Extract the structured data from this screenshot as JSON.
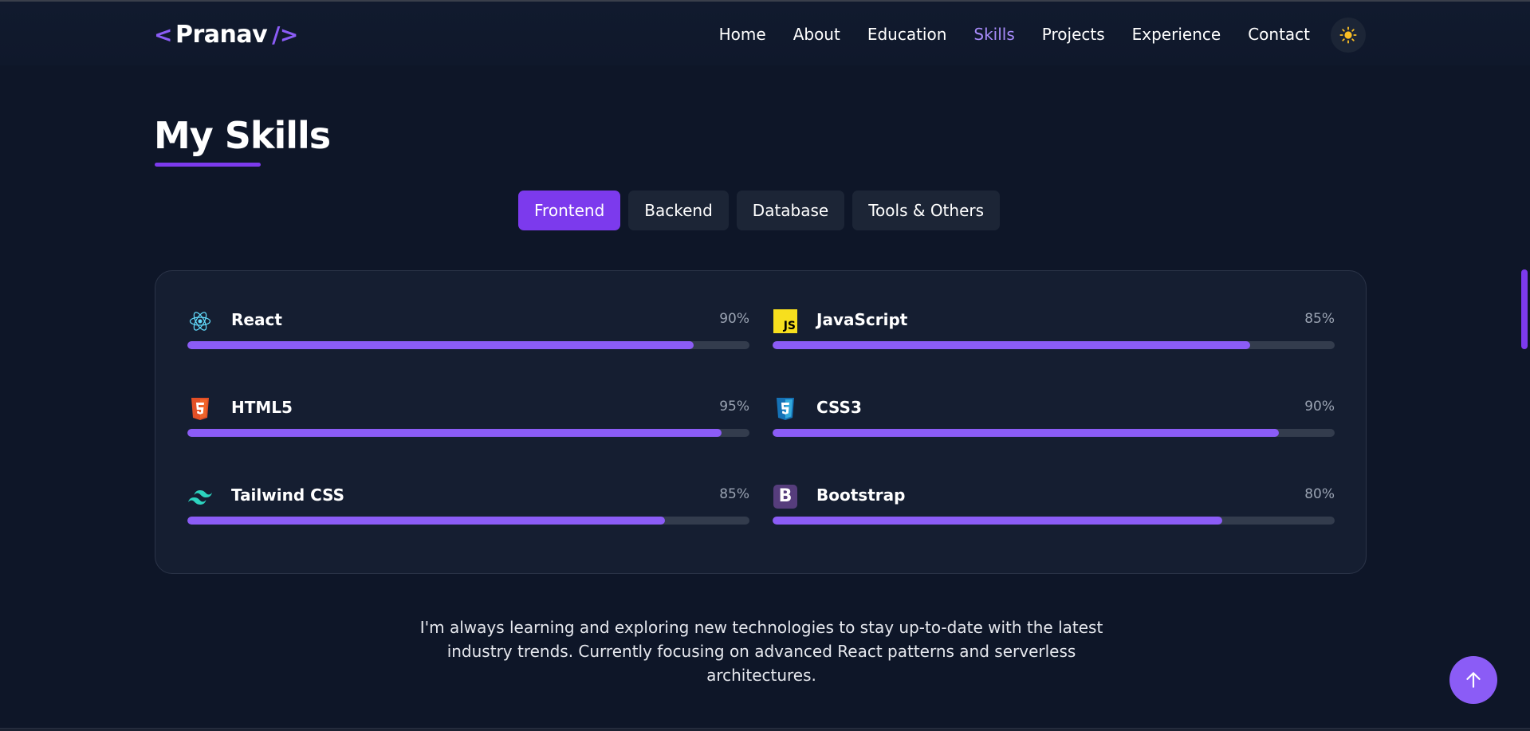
{
  "logo": {
    "open": "<",
    "name": "Pranav",
    "close": "/>"
  },
  "nav": {
    "items": [
      {
        "label": "Home"
      },
      {
        "label": "About"
      },
      {
        "label": "Education"
      },
      {
        "label": "Skills",
        "active": true
      },
      {
        "label": "Projects"
      },
      {
        "label": "Experience"
      },
      {
        "label": "Contact"
      }
    ],
    "theme_toggle_icon": "sun-icon"
  },
  "section": {
    "title": "My Skills",
    "tabs": [
      {
        "label": "Frontend",
        "active": true
      },
      {
        "label": "Backend"
      },
      {
        "label": "Database"
      },
      {
        "label": "Tools & Others"
      }
    ],
    "skills": [
      {
        "name": "React",
        "percent_label": "90%",
        "level": 0.9,
        "icon": "react-icon"
      },
      {
        "name": "JavaScript",
        "percent_label": "85%",
        "level": 0.85,
        "icon": "javascript-icon"
      },
      {
        "name": "HTML5",
        "percent_label": "95%",
        "level": 0.95,
        "icon": "html5-icon"
      },
      {
        "name": "CSS3",
        "percent_label": "90%",
        "level": 0.9,
        "icon": "css3-icon"
      },
      {
        "name": "Tailwind CSS",
        "percent_label": "85%",
        "level": 0.85,
        "icon": "tailwind-icon"
      },
      {
        "name": "Bootstrap",
        "percent_label": "80%",
        "level": 0.8,
        "icon": "bootstrap-icon"
      }
    ],
    "note": "I'm always learning and exploring new technologies to stay up-to-date with the latest industry trends. Currently focusing on advanced React patterns and serverless architectures."
  },
  "icon_text": {
    "javascript": "JS",
    "bootstrap": "B"
  },
  "colors": {
    "accent": "#8b5cf6",
    "accent_dark": "#7c3aed",
    "background": "#0e1628",
    "card": "#151e31",
    "track": "#333c4d"
  },
  "back_to_top_icon": "arrow-up-icon"
}
